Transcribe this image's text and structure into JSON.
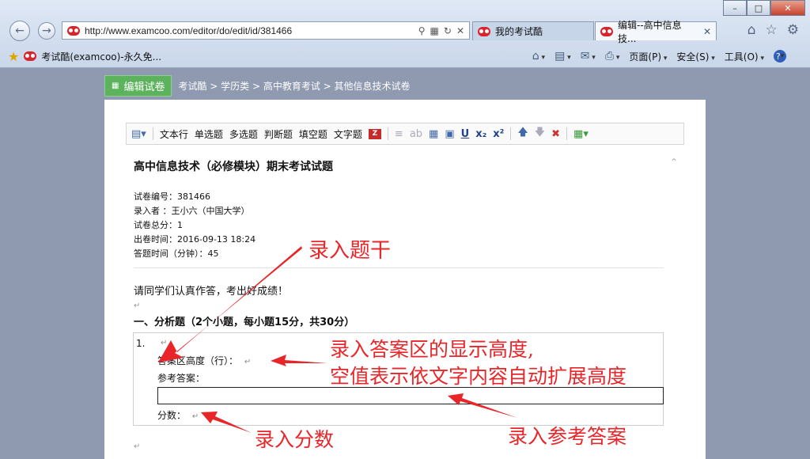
{
  "browser": {
    "url": "http://www.examcoo.com/editor/do/edit/id/381466",
    "tabs": [
      {
        "label": "我的考试酷"
      },
      {
        "label": "编辑--高中信息技..."
      }
    ],
    "favorite": "考试酷(examcoo)-永久免...",
    "commands": {
      "page": "页面(P)",
      "safety": "安全(S)",
      "tools": "工具(O)"
    }
  },
  "page": {
    "edit_button": "编辑试卷",
    "breadcrumb": "考试酷 > 学历类 > 高中教育考试 > 其他信息技术试卷"
  },
  "toolbar": {
    "items": [
      "文本行",
      "单选题",
      "多选题",
      "判断题",
      "填空题",
      "文字题"
    ]
  },
  "doc": {
    "title": "高中信息技术（必修模块）期末考试试题",
    "meta": [
      "试卷编号：381466",
      "录入者  ：王小六（中国大学）",
      "试卷总分：1",
      "出卷时间：2016-09-13 18:24",
      "答题时间（分钟）：45"
    ],
    "intro": "请同学们认真作答，考出好成绩！",
    "section": "一、分析题（2个小题，每小题15分，共30分）",
    "question": {
      "number": "1.",
      "answer_height_label": "答案区高度（行）：",
      "reference_answer_label": "参考答案：",
      "score_label": "分数："
    }
  },
  "annotations": {
    "stem": "录入题干",
    "height_line1": "录入答案区的显示高度,",
    "height_line2": "空值表示依文字内容自动扩展高度",
    "score": "录入分数",
    "answer": "录入参考答案"
  },
  "colors": {
    "annotation": "#e8262a",
    "edit_button": "#5db35d",
    "page_bg": "#8f99b0"
  }
}
